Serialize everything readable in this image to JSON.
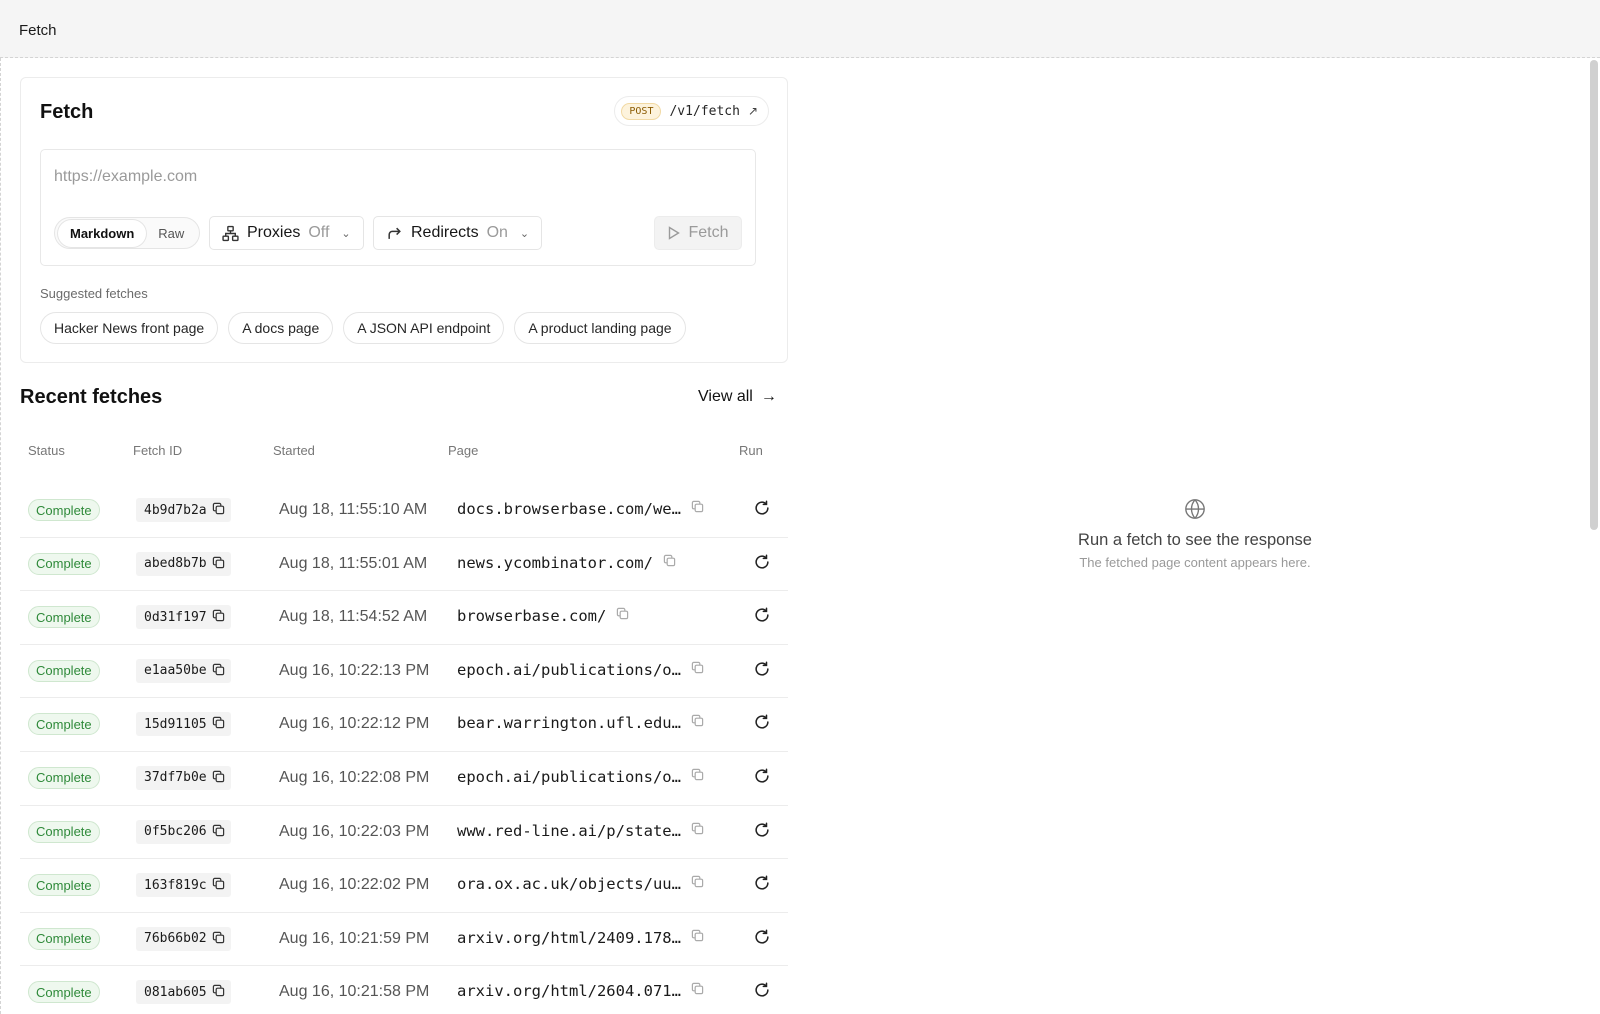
{
  "topbar": {
    "title": "Fetch"
  },
  "card": {
    "title": "Fetch",
    "endpoint": {
      "method": "POST",
      "path": "/v1/fetch"
    },
    "url_placeholder": "https://example.com",
    "format": {
      "options": [
        "Markdown",
        "Raw"
      ],
      "selected": "Markdown"
    },
    "proxies": {
      "label": "Proxies",
      "value": "Off"
    },
    "redirects": {
      "label": "Redirects",
      "value": "On"
    },
    "fetch_button": "Fetch",
    "suggested_label": "Suggested fetches",
    "suggestions": [
      "Hacker News front page",
      "A docs page",
      "A JSON API endpoint",
      "A product landing page"
    ]
  },
  "recent": {
    "title": "Recent fetches",
    "view_all": "View all",
    "columns": {
      "status": "Status",
      "fetch_id": "Fetch ID",
      "started": "Started",
      "page": "Page",
      "run": "Run"
    },
    "rows": [
      {
        "status": "Complete",
        "id": "4b9d7b2a",
        "started": "Aug 18, 11:55:10 AM",
        "page": "docs.browserbase.com/we…"
      },
      {
        "status": "Complete",
        "id": "abed8b7b",
        "started": "Aug 18, 11:55:01 AM",
        "page": "news.ycombinator.com/"
      },
      {
        "status": "Complete",
        "id": "0d31f197",
        "started": "Aug 18, 11:54:52 AM",
        "page": "browserbase.com/"
      },
      {
        "status": "Complete",
        "id": "e1aa50be",
        "started": "Aug 16, 10:22:13 PM",
        "page": "epoch.ai/publications/o…"
      },
      {
        "status": "Complete",
        "id": "15d91105",
        "started": "Aug 16, 10:22:12 PM",
        "page": "bear.warrington.ufl.edu…"
      },
      {
        "status": "Complete",
        "id": "37df7b0e",
        "started": "Aug 16, 10:22:08 PM",
        "page": "epoch.ai/publications/o…"
      },
      {
        "status": "Complete",
        "id": "0f5bc206",
        "started": "Aug 16, 10:22:03 PM",
        "page": "www.red-line.ai/p/state…"
      },
      {
        "status": "Complete",
        "id": "163f819c",
        "started": "Aug 16, 10:22:02 PM",
        "page": "ora.ox.ac.uk/objects/uu…"
      },
      {
        "status": "Complete",
        "id": "76b66b02",
        "started": "Aug 16, 10:21:59 PM",
        "page": "arxiv.org/html/2409.178…"
      },
      {
        "status": "Complete",
        "id": "081ab605",
        "started": "Aug 16, 10:21:58 PM",
        "page": "arxiv.org/html/2604.071…"
      }
    ]
  },
  "response_panel": {
    "empty_title": "Run a fetch to see the response",
    "empty_subtitle": "The fetched page content appears here."
  },
  "colors": {
    "status_complete": "#2f8a3a",
    "post_badge": "#8a5a00"
  }
}
